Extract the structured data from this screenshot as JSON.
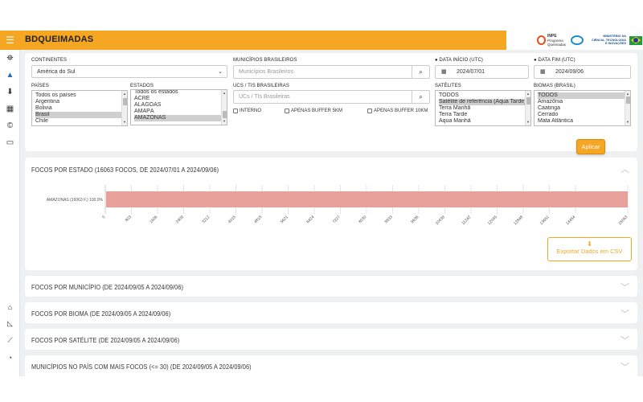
{
  "app": {
    "title": "BDQUEIMADAS"
  },
  "logos": {
    "inpe": "INPE",
    "inpe_sub1": "Programa",
    "inpe_sub2": "Queimadas",
    "ministry1": "MINISTÉRIO DA",
    "ministry2": "CIÊNCIA, TECNOLOGIA",
    "ministry3": "E INOVAÇÕES"
  },
  "sidebar": {
    "logo_icon": "database-icon",
    "items": [
      {
        "icon": "map-marker-icon",
        "glyph": "⛯"
      },
      {
        "icon": "chart-line-icon",
        "glyph": "▲"
      },
      {
        "icon": "download-icon",
        "glyph": "⬇"
      },
      {
        "icon": "table-icon",
        "glyph": "▦"
      },
      {
        "icon": "copyright-icon",
        "glyph": "©"
      },
      {
        "icon": "monitor-icon",
        "glyph": "▭"
      }
    ],
    "bottom": [
      {
        "icon": "home-icon",
        "glyph": "⌂"
      },
      {
        "icon": "area-chart-icon",
        "glyph": "◺"
      },
      {
        "icon": "line-chart-icon",
        "glyph": "⟋"
      },
      {
        "icon": "pie-chart-icon",
        "glyph": "◔"
      }
    ]
  },
  "filters": {
    "continentes": {
      "label": "CONTINENTES",
      "value": "América do Sul"
    },
    "municipios": {
      "label": "MUNICÍPIOS BRASILEIROS",
      "placeholder": "Municípios Brasileiros"
    },
    "data_inicio": {
      "label": "DATA INÍCIO (UTC)",
      "value": "2024/07/01"
    },
    "data_fim": {
      "label": "DATA FIM (UTC)",
      "value": "2024/09/06"
    },
    "paises": {
      "label": "PAÍSES",
      "options": [
        "Todos os países",
        "Argentina",
        "Bolivia",
        "Brasil",
        "Chile"
      ],
      "selected": "Brasil"
    },
    "estados": {
      "label": "ESTADOS",
      "options": [
        "Todos os estados",
        "ACRE",
        "ALAGOAS",
        "AMAPÁ",
        "AMAZONAS"
      ],
      "selected": "AMAZONAS"
    },
    "ucs": {
      "label": "UCS / TIS BRASILEIRAS",
      "placeholder": "UCs / TIs Brasileiras"
    },
    "checks": {
      "interno": "INTERNO",
      "buffer5": "APENAS BUFFER 5KM",
      "buffer10": "APENAS BUFFER 10KM"
    },
    "satelites": {
      "label": "SATÉLITES",
      "options": [
        "TODOS",
        "Satélite de referência (Aqua Tarde)",
        "Terra Manhã",
        "Terra Tarde",
        "Aqua Manhã"
      ],
      "selected": "Satélite de referência (Aqua Tarde)"
    },
    "biomas": {
      "label": "BIOMAS (BRASIL)",
      "options": [
        "TODOS",
        "Amazônia",
        "Caatinga",
        "Cerrado",
        "Mata Atlântica"
      ],
      "selected": "TODOS"
    },
    "apply_label": "Aplicar"
  },
  "panels": {
    "estado_title": "FOCOS POR ESTADO (16063 FOCOS, DE 2024/07/01 A 2024/09/06)",
    "export_label": "Exportar Dados em CSV",
    "municipio_title": "FOCOS POR MUNICÍPIO (DE 2024/09/05 A 2024/09/06)",
    "bioma_title": "FOCOS POR BIOMA (DE 2024/09/05 A 2024/09/06)",
    "satelite_title": "FOCOS POR SATÉLITE (DE 2024/09/05 A 2024/09/06)",
    "municipios_pais_title": "MUNICÍPIOS NO PAÍS COM MAIS FOCOS (<= 30) (DE 2024/09/05 A 2024/09/06)"
  },
  "colors": {
    "accent": "#f5a623",
    "bar": "#e8a09a"
  },
  "chart_data": {
    "type": "bar",
    "orientation": "horizontal",
    "categories": [
      "AMAZONAS (16063 F.) 100.0%"
    ],
    "values": [
      16063
    ],
    "xlim": [
      0,
      16063
    ],
    "xticks": [
      0,
      803,
      1606,
      2409,
      3212,
      4015,
      4818,
      5621,
      6424,
      7227,
      8030,
      8833,
      9636,
      10439,
      11242,
      12045,
      12848,
      13651,
      14454,
      16063
    ],
    "grid": true
  }
}
